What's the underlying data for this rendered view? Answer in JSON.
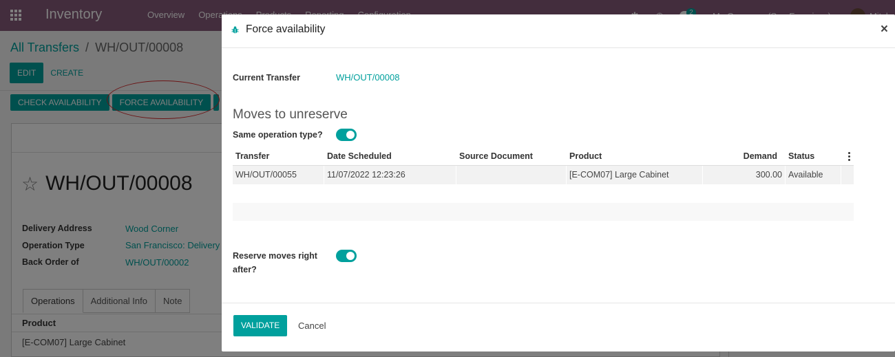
{
  "navbar": {
    "app_name": "Inventory",
    "menu": [
      "Overview",
      "Operations",
      "Products",
      "Reporting",
      "Configuration"
    ],
    "chat_count": "2",
    "company": "My Company (San Francisco)",
    "user": "Mitchell"
  },
  "breadcrumb": {
    "parent": "All Transfers",
    "separator": "/",
    "current": "WH/OUT/00008"
  },
  "control_panel": {
    "edit": "EDIT",
    "create": "CREATE"
  },
  "header_buttons": {
    "check_availability": "CHECK AVAILABILITY",
    "force_availability": "FORCE AVAILABILITY"
  },
  "record": {
    "name": "WH/OUT/00008",
    "fields": [
      {
        "label": "Delivery Address",
        "value": "Wood Corner"
      },
      {
        "label": "Operation Type",
        "value": "San Francisco: Delivery O"
      },
      {
        "label": "Back Order of",
        "value": "WH/OUT/00002"
      }
    ],
    "tabs": [
      "Operations",
      "Additional Info",
      "Note"
    ],
    "ops_header": "Product",
    "ops_row": "[E-COM07] Large Cabinet"
  },
  "modal": {
    "title": "Force availability",
    "current_transfer_label": "Current Transfer",
    "current_transfer_value": "WH/OUT/00008",
    "section_title": "Moves to unreserve",
    "same_op_label": "Same operation type?",
    "same_op_on": true,
    "columns": [
      "Transfer",
      "Date Scheduled",
      "Source Document",
      "Product",
      "Demand",
      "Status"
    ],
    "rows": [
      {
        "transfer": "WH/OUT/00055",
        "date": "11/07/2022 12:23:26",
        "source": "",
        "product": "[E-COM07] Large Cabinet",
        "demand": "300.00",
        "status": "Available"
      }
    ],
    "reserve_label_1": "Reserve moves right",
    "reserve_label_2": "after?",
    "reserve_on": true,
    "validate": "VALIDATE",
    "cancel": "Cancel"
  },
  "colors": {
    "navbar": "#875a7b",
    "accent": "#00a09d",
    "annotation": "#d62728"
  }
}
